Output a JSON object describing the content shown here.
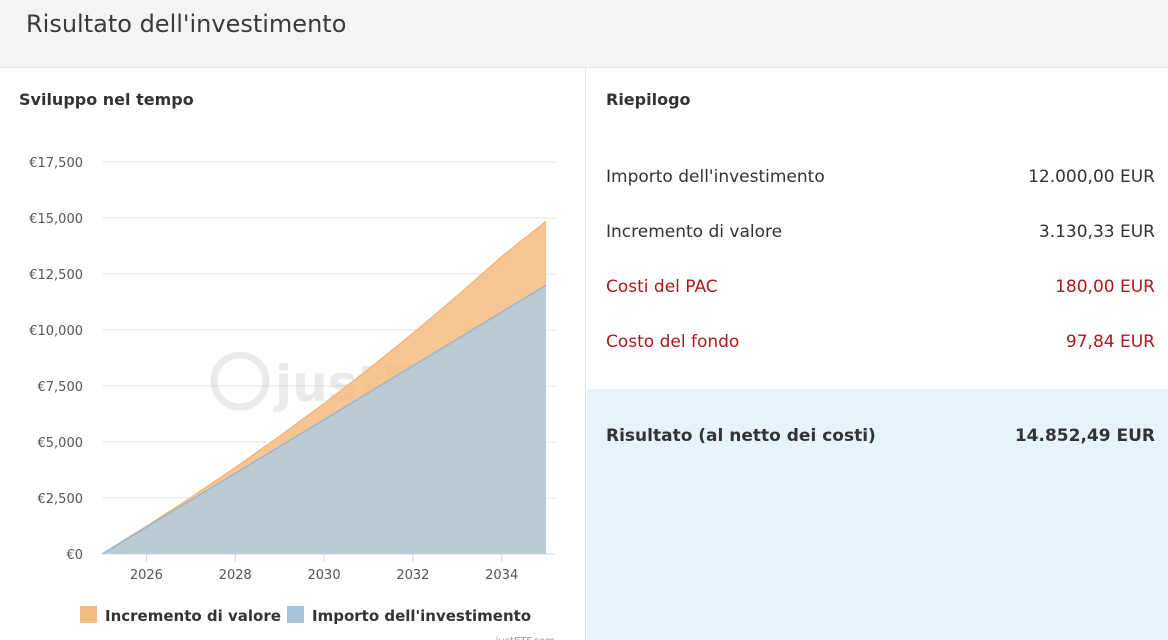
{
  "page": {
    "title": "Risultato dell'investimento"
  },
  "left": {
    "title": "Sviluppo nel tempo"
  },
  "right": {
    "title": "Riepilogo"
  },
  "summary": {
    "rows": [
      {
        "label": "Importo dell'investimento",
        "value": "12.000,00 EUR",
        "color": "#333333"
      },
      {
        "label": "Incremento di valore",
        "value": "3.130,33 EUR",
        "color": "#333333"
      },
      {
        "label": "Costi del PAC",
        "value": "180,00 EUR",
        "color": "#b0171b"
      },
      {
        "label": "Costo del fondo",
        "value": "97,84 EUR",
        "color": "#b0171b"
      }
    ],
    "result_label": "Risultato (al netto dei costi)",
    "result_value": "14.852,49 EUR"
  },
  "chart_data": {
    "type": "area",
    "stacked": true,
    "x": [
      2025,
      2026,
      2027,
      2028,
      2029,
      2030,
      2031,
      2032,
      2033,
      2034,
      2035
    ],
    "series": [
      {
        "name": "Importo dell'investimento",
        "color": "#a9c4da",
        "values": [
          0,
          1200,
          2400,
          3600,
          4800,
          6000,
          7200,
          8400,
          9600,
          10800,
          12000
        ]
      },
      {
        "name": "Incremento di valore",
        "color": "#f6bb80",
        "values": [
          0,
          40,
          120,
          260,
          460,
          720,
          1050,
          1450,
          1930,
          2480,
          2850
        ]
      }
    ],
    "xticks": [
      2026,
      2028,
      2030,
      2032,
      2034
    ],
    "xlim": [
      2025,
      2035.2
    ],
    "yticks": [
      0,
      2500,
      5000,
      7500,
      10000,
      12500,
      15000,
      17500
    ],
    "ytick_labels": [
      "€0",
      "€2,500",
      "€5,000",
      "€7,500",
      "€10,000",
      "€12,500",
      "€15,000",
      "€17,500"
    ],
    "ylim": [
      0,
      17500
    ],
    "grid": "horizontal",
    "legend_position": "bottom",
    "watermark": "justETF",
    "credit": "justETF.com"
  }
}
